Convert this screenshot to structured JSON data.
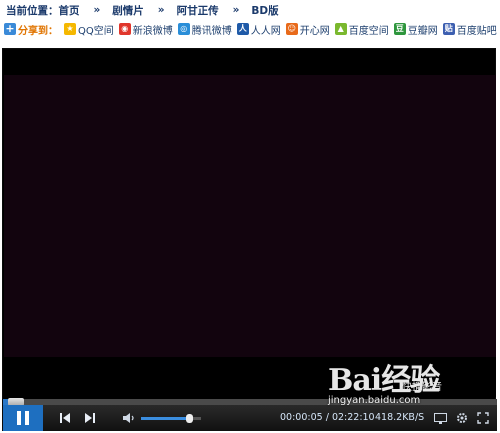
{
  "breadcrumb": {
    "prefix": "当前位置：",
    "items": [
      "首页",
      "剧情片",
      "阿甘正传",
      "BD版"
    ],
    "separator": "»"
  },
  "share": {
    "label": "分享到：",
    "items": [
      {
        "label": "QQ空间",
        "icon": "qzone-icon",
        "color": "#f5b800"
      },
      {
        "label": "新浪微博",
        "icon": "weibo-icon",
        "color": "#e0362c"
      },
      {
        "label": "腾讯微博",
        "icon": "tencent-weibo-icon",
        "color": "#2a8ed8"
      },
      {
        "label": "人人网",
        "icon": "renren-icon",
        "color": "#1f5aa8"
      },
      {
        "label": "开心网",
        "icon": "kaixin-icon",
        "color": "#e86a1a"
      },
      {
        "label": "百度空间",
        "icon": "baidu-space-icon",
        "color": "#7ab82e"
      },
      {
        "label": "豆瓣网",
        "icon": "douban-icon",
        "color": "#2e963d"
      },
      {
        "label": "百度贴吧",
        "icon": "tieba-icon",
        "color": "#3d5fb0"
      }
    ]
  },
  "player": {
    "current_time": "00:00:05",
    "time_separator": "/",
    "total_time": "02:22:10",
    "speed": "418.2KB/S",
    "progress_fraction": 0.01,
    "volume_fraction": 0.8,
    "state": "playing",
    "colors": {
      "accent": "#1e6fc0",
      "video": "#12040e"
    }
  },
  "watermark": {
    "logo": "Bai经验",
    "sub": "快播影音",
    "url": "jingyan.baidu.com"
  }
}
